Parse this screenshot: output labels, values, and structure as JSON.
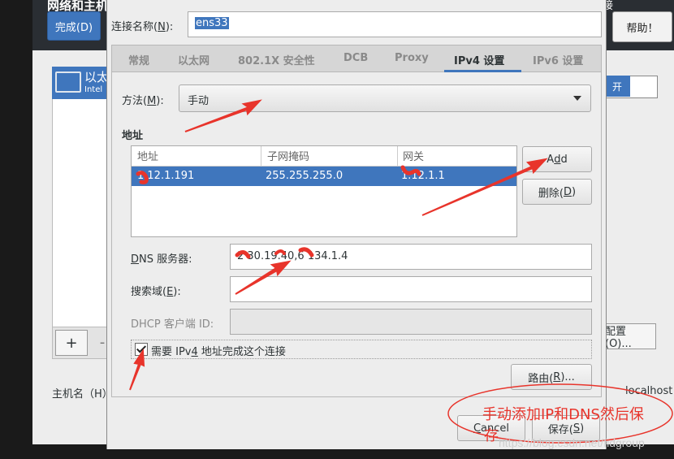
{
  "background": {
    "title": "网络和主机",
    "right_text": "接",
    "done_button": "完成(D)",
    "help_button": "帮助！",
    "connection_name": "以太",
    "connection_sub": "Intel",
    "toggle_label": "开",
    "config_button": "配置(O)...",
    "hostname_label": "主机名（H）",
    "hostname_value": "localhost",
    "plus": "+",
    "minus": "-"
  },
  "dialog": {
    "conn_name_label_pre": "连接名称(",
    "conn_name_label_key": "N",
    "conn_name_label_post": "):",
    "conn_name_value": "ens33",
    "tabs": [
      {
        "label": "常规"
      },
      {
        "label": "以太网"
      },
      {
        "label": "802.1X 安全性"
      },
      {
        "label": "DCB"
      },
      {
        "label": "Proxy"
      },
      {
        "label": "IPv4 设置"
      },
      {
        "label": "IPv6 设置"
      }
    ],
    "active_tab": "IPv4 设置",
    "method_label_pre": "方法(",
    "method_label_key": "M",
    "method_label_post": "):",
    "method_value": "手动",
    "address_section": "地址",
    "address_columns": [
      "地址",
      "子网掩码",
      "网关"
    ],
    "address_rows": [
      {
        "address": "1.12.1.191",
        "netmask": "255.255.255.0",
        "gateway": "1.12.1.1"
      }
    ],
    "add_button_pre": "A",
    "add_button_key": "d",
    "add_button_post": "d",
    "delete_button": "删除(",
    "delete_key": "D",
    "delete_post": ")",
    "dns_label_pre": "",
    "dns_label_key": "D",
    "dns_label_post": "NS 服务器:",
    "dns_value": "2 30.19.40,6 134.1.4",
    "search_label_pre": "搜索域(",
    "search_label_key": "E",
    "search_label_post": "):",
    "dhcp_label": "DHCP 客户端 ID:",
    "require_ipv4_pre": "需要 IPv",
    "require_ipv4_key": "4",
    "require_ipv4_post": " 地址完成这个连接",
    "routes_button_pre": "路由(",
    "routes_button_key": "R",
    "routes_button_post": ")...",
    "cancel_pre": "",
    "cancel_key": "C",
    "cancel_post": "ancel",
    "save_pre": "保存(",
    "save_key": "S",
    "save_post": ")"
  },
  "annotation": {
    "note_line1": "手动添加IP和DNS然后保",
    "note_line2": "存",
    "watermark": "https://blog.csdn.net/fidgroup",
    "color": "#e8342b"
  }
}
